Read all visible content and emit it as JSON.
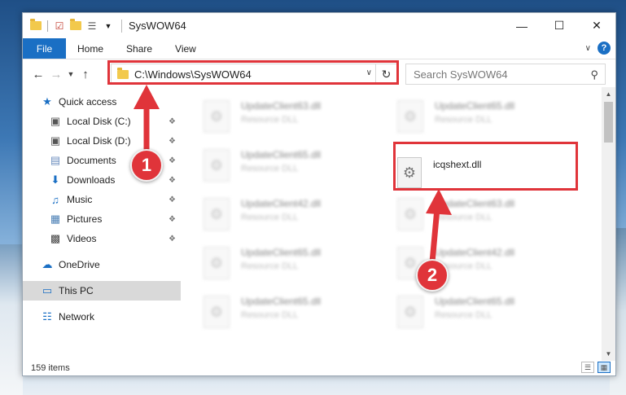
{
  "window": {
    "title": "SysWOW64"
  },
  "ribbon": {
    "tabs": [
      "File",
      "Home",
      "Share",
      "View"
    ]
  },
  "navbar": {
    "address": "C:\\Windows\\SysWOW64",
    "search_placeholder": "Search SysWOW64"
  },
  "sidebar": {
    "items": [
      {
        "label": "Quick access",
        "icon": "star-icon"
      },
      {
        "label": "Local Disk (C:)",
        "icon": "drive-icon"
      },
      {
        "label": "Local Disk (D:)",
        "icon": "drive-icon"
      },
      {
        "label": "Documents",
        "icon": "documents-icon"
      },
      {
        "label": "Downloads",
        "icon": "download-icon"
      },
      {
        "label": "Music",
        "icon": "music-icon"
      },
      {
        "label": "Pictures",
        "icon": "pictures-icon"
      },
      {
        "label": "Videos",
        "icon": "videos-icon"
      },
      {
        "label": "OneDrive",
        "icon": "cloud-icon"
      },
      {
        "label": "This PC",
        "icon": "computer-icon"
      },
      {
        "label": "Network",
        "icon": "network-icon"
      }
    ]
  },
  "files": [
    {
      "name": "UpdateClient63.dll",
      "type": "Resource DLL"
    },
    {
      "name": "UpdateClient65.dll",
      "type": "Resource DLL"
    },
    {
      "name": "UpdateClient65.dll",
      "type": "Resource DLL"
    },
    {
      "name": "icqshext.dll",
      "type": ""
    },
    {
      "name": "UpdateClient42.dll",
      "type": "Resource DLL"
    },
    {
      "name": "UpdateClient63.dll",
      "type": "Resource DLL"
    },
    {
      "name": "UpdateClient65.dll",
      "type": "Resource DLL"
    },
    {
      "name": "UpdateClient42.dll",
      "type": "Resource DLL"
    },
    {
      "name": "UpdateClient65.dll",
      "type": "Resource DLL"
    },
    {
      "name": "UpdateClient65.dll",
      "type": "Resource DLL"
    }
  ],
  "status": {
    "item_count": "159 items"
  },
  "annotations": {
    "step1": "1",
    "step2": "2"
  },
  "colors": {
    "accent": "#1a6fc4",
    "highlight": "#e0343a"
  }
}
